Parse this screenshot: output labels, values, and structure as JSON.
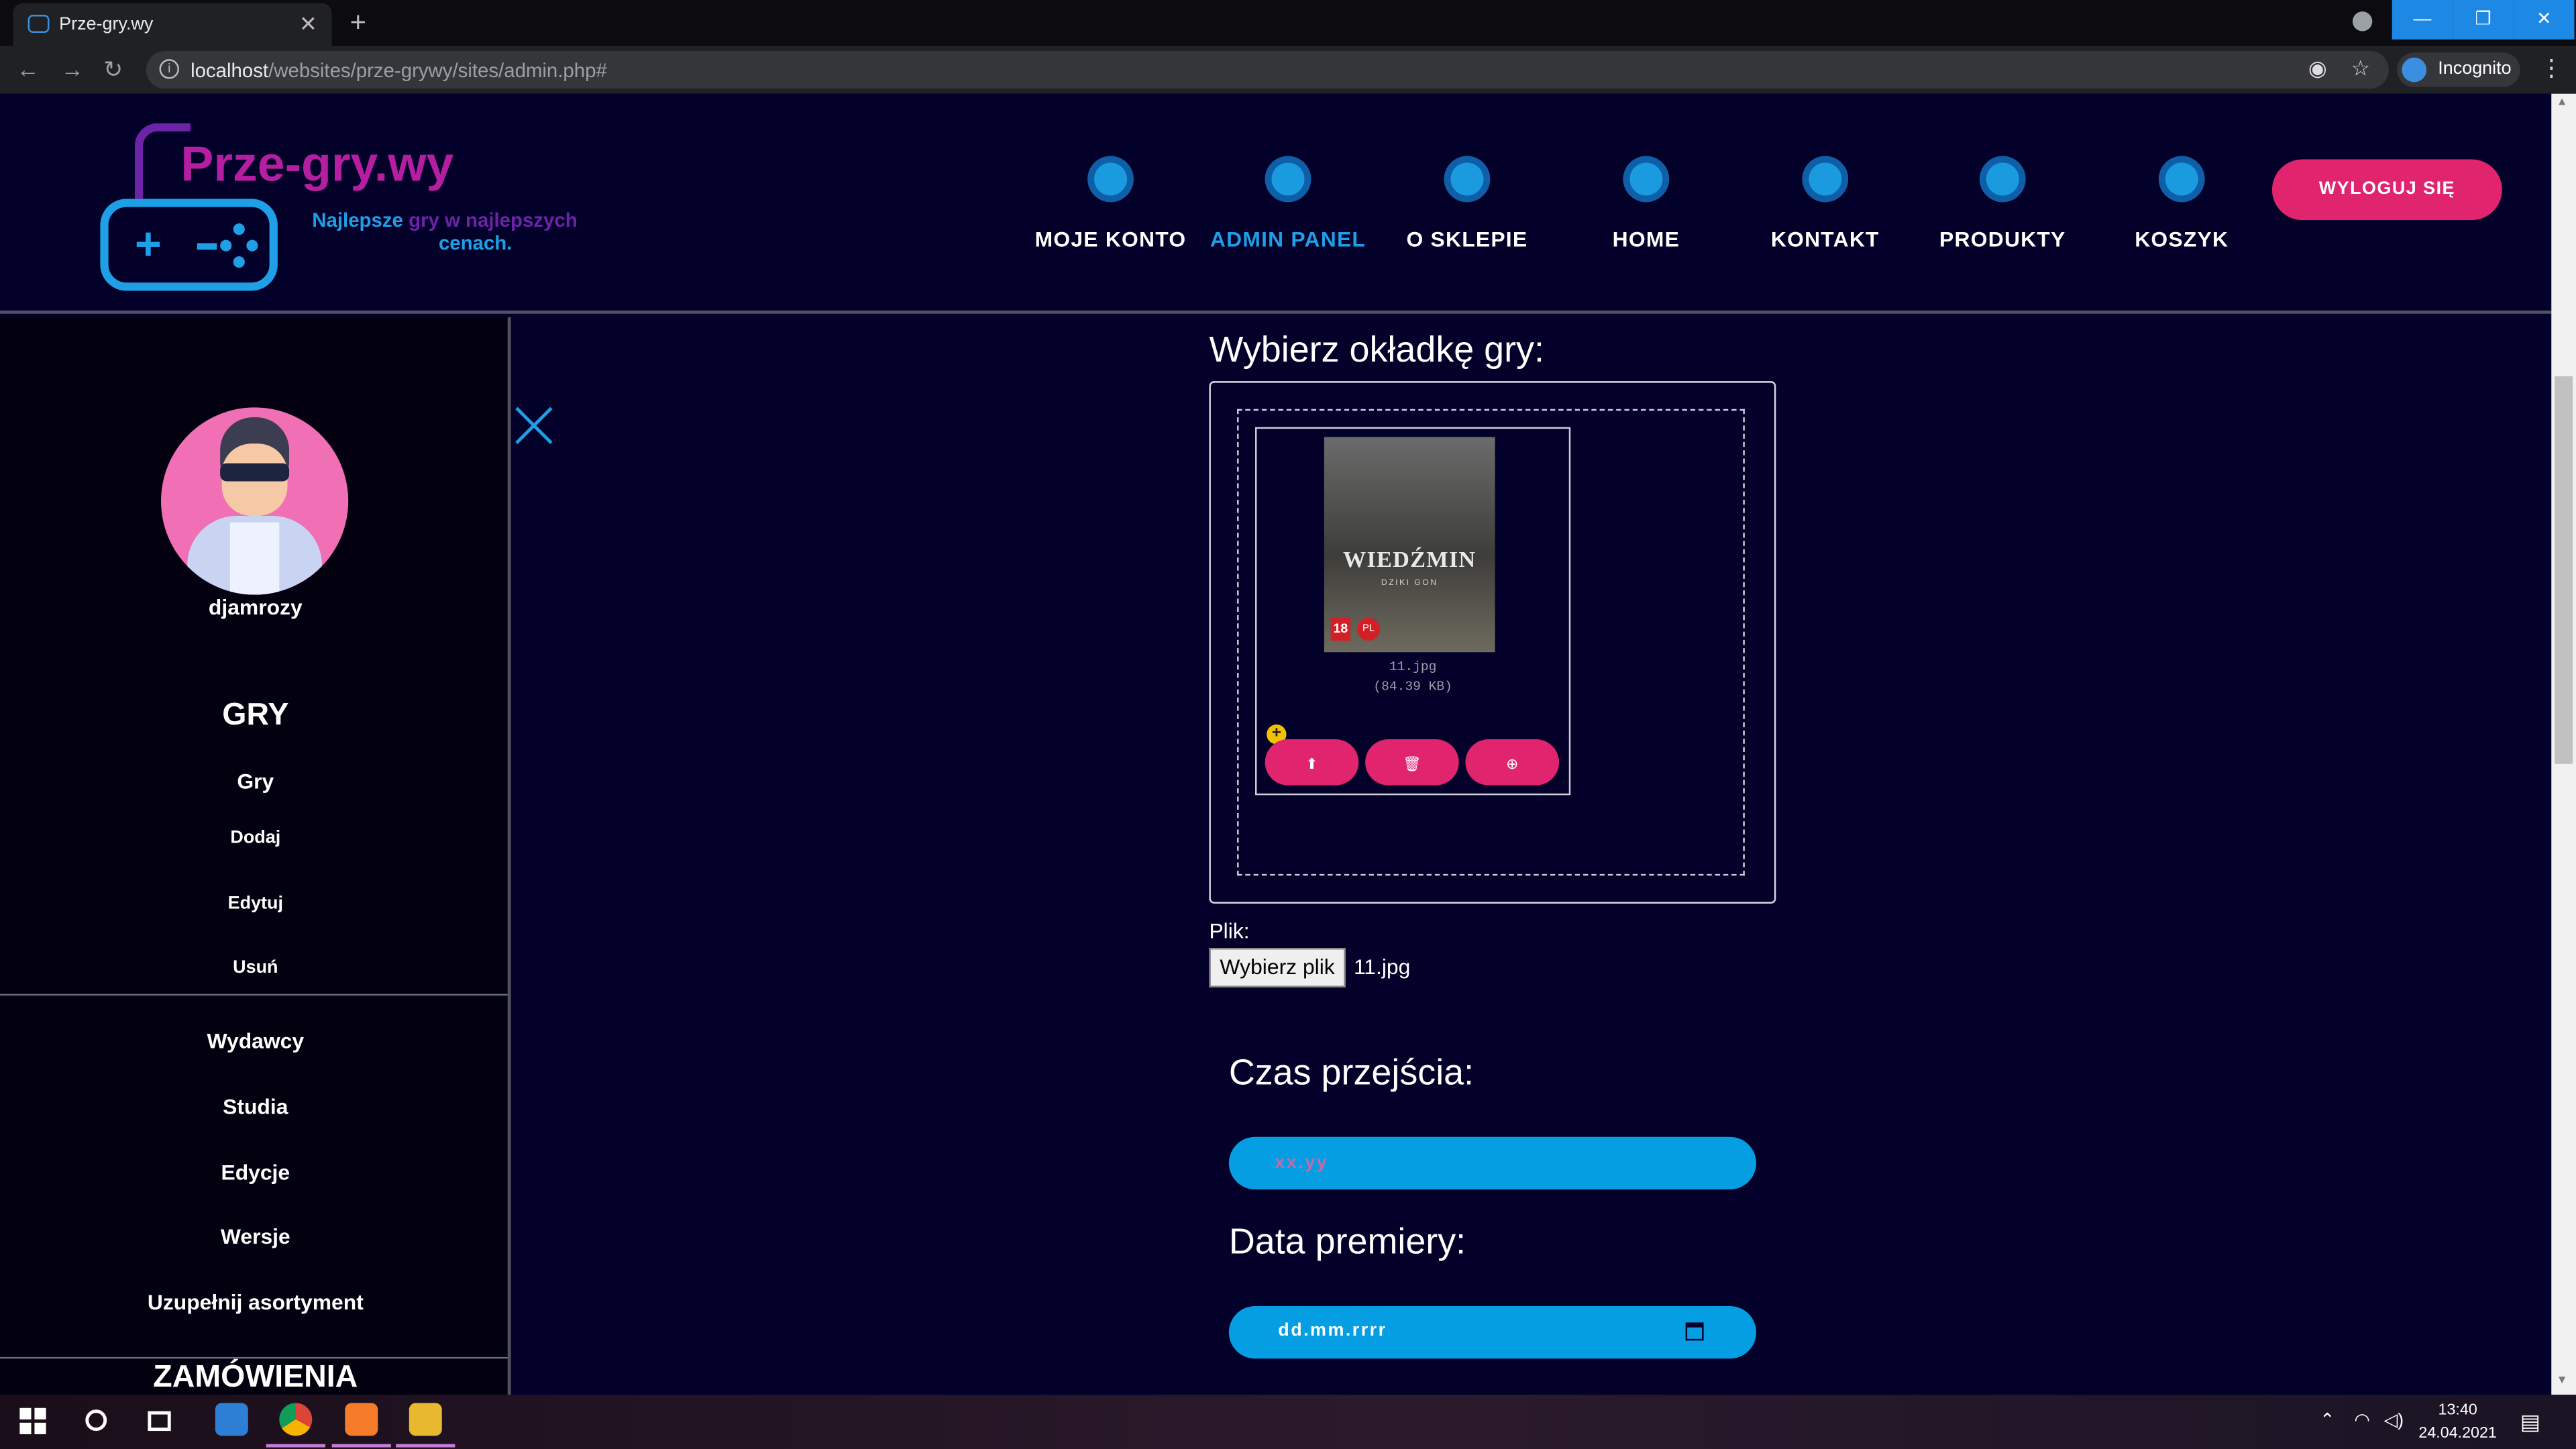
{
  "browser": {
    "tab_title": "Prze-gry.wy",
    "url_host": "localhost",
    "url_path": "/websites/prze-grywy/sites/admin.php#",
    "profile_label": "Incognito"
  },
  "header": {
    "logo_text": "Prze-gry.wy",
    "slogan_1": "Najlepsze",
    "slogan_2": "gry",
    "slogan_3": "w najlepszych",
    "slogan_4": "cenach.",
    "nav": [
      {
        "label": "MOJE KONTO",
        "icon": "account-icon"
      },
      {
        "label": "ADMIN PANEL",
        "icon": "admin-icon",
        "active": true
      },
      {
        "label": "O SKLEPIE",
        "icon": "about-icon"
      },
      {
        "label": "HOME",
        "icon": "home-icon"
      },
      {
        "label": "KONTAKT",
        "icon": "contact-icon"
      },
      {
        "label": "PRODUKTY",
        "icon": "products-icon"
      },
      {
        "label": "KOSZYK",
        "icon": "cart-icon"
      }
    ],
    "logout_label": "WYLOGUJ SIĘ"
  },
  "sidebar": {
    "username": "djamrozy",
    "section_games": "GRY",
    "games_links": [
      "Gry",
      "Dodaj",
      "Edytuj",
      "Usuń"
    ],
    "other_links": [
      "Wydawcy",
      "Studia",
      "Edycje",
      "Wersje",
      "Uzupełnij asortyment"
    ],
    "section_orders": "ZAMÓWIENIA"
  },
  "form": {
    "cover_label": "Wybierz okładkę gry:",
    "cover_title": "WIEDŹMIN",
    "cover_subtitle": "DZIKI GON",
    "cover_age": "18",
    "cover_rating": "PL",
    "file_name": "11.jpg",
    "file_size": "(84.39 KB)",
    "file_label": "Plik:",
    "pick_button": "Wybierz plik",
    "picked_file": "11.jpg",
    "playtime_label": "Czas przejścia:",
    "playtime_placeholder": "xx.yy",
    "release_label": "Data premiery:",
    "release_placeholder": "dd.mm.rrrr"
  },
  "taskbar": {
    "time": "13:40",
    "date": "24.04.2021"
  },
  "colors": {
    "page_bg": "#03012a",
    "accent_pink": "#e0246e",
    "accent_blue": "#069ee3",
    "logo_purple": "#b51ea0"
  }
}
